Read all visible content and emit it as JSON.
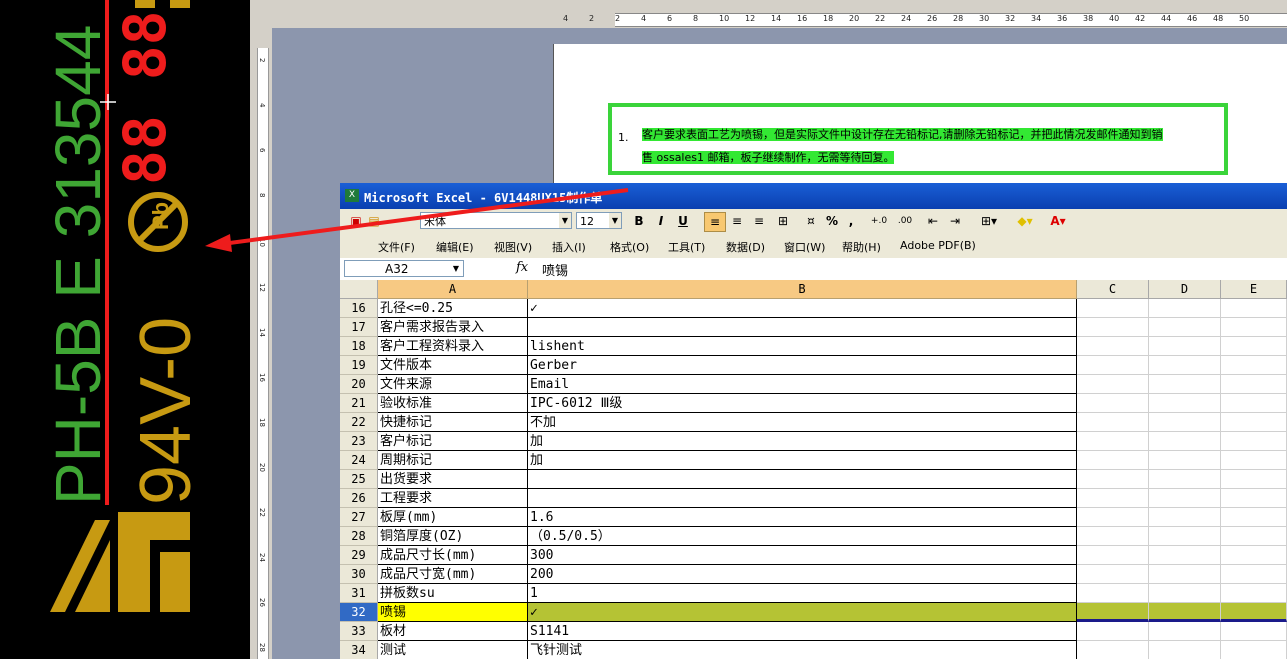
{
  "cad_panel": {
    "silkscreen_green": "PH-5B  E 313544",
    "silkscreen_yellow": "94V-0",
    "pb_free_symbol": "Pb",
    "seven_segment_digits": "88 88",
    "colors": {
      "green": "#3fa634",
      "yellow": "#c79a12",
      "red": "#ee1c1c"
    }
  },
  "word": {
    "ruler_ticks": [
      "4",
      "2",
      "2",
      "4",
      "6",
      "8",
      "10",
      "12",
      "14",
      "16",
      "18",
      "20",
      "22",
      "24",
      "26",
      "28",
      "30",
      "32",
      "34",
      "36",
      "38",
      "40",
      "42",
      "44",
      "46",
      "48",
      "50"
    ],
    "vruler_ticks": [
      "2",
      "4",
      "6",
      "8",
      "10",
      "12",
      "14",
      "16",
      "18",
      "20",
      "22",
      "24",
      "26",
      "28"
    ],
    "list_number": "1.",
    "note_line1": "客户要求表面工艺为喷锡，但是实际文件中设计存在无铅标记,请删除无铅标记，并把此情况发邮件通知到销",
    "note_line2": "售 ossales1 邮箱，板子继续制作，无需等待回复。",
    "highlight_color": "#33e833"
  },
  "excel": {
    "title": "Microsoft Excel - 6V1448UX15制作单",
    "font_name": "宋体",
    "font_size": "12",
    "toolbar": {
      "bold": "B",
      "italic": "I",
      "underline": "U",
      "percent": "%",
      "comma": ",",
      "font_color_label": "A"
    },
    "menu": [
      "文件(F)",
      "编辑(E)",
      "视图(V)",
      "插入(I)",
      "格式(O)",
      "工具(T)",
      "数据(D)",
      "窗口(W)",
      "帮助(H)",
      "Adobe PDF(B)"
    ],
    "name_box": "A32",
    "fx_label": "fx",
    "formula_content": "喷锡",
    "columns": [
      "A",
      "B",
      "C",
      "D",
      "E"
    ],
    "rows": [
      {
        "num": "16",
        "a": "孔径<=0.25",
        "b": "✓"
      },
      {
        "num": "17",
        "a": "客户需求报告录入",
        "b": ""
      },
      {
        "num": "18",
        "a": "客户工程资料录入",
        "b": "lishent"
      },
      {
        "num": "19",
        "a": "文件版本",
        "b": "Gerber"
      },
      {
        "num": "20",
        "a": "文件来源",
        "b": "Email"
      },
      {
        "num": "21",
        "a": "验收标准",
        "b": "IPC-6012 Ⅲ级"
      },
      {
        "num": "22",
        "a": "快捷标记",
        "b": "不加"
      },
      {
        "num": "23",
        "a": "客户标记",
        "b": "加"
      },
      {
        "num": "24",
        "a": "周期标记",
        "b": "加"
      },
      {
        "num": "25",
        "a": "出货要求",
        "b": ""
      },
      {
        "num": "26",
        "a": "工程要求",
        "b": ""
      },
      {
        "num": "27",
        "a": "板厚(mm)",
        "b": "1.6"
      },
      {
        "num": "28",
        "a": "铜箔厚度(OZ)",
        "b": "（0.5/0.5）"
      },
      {
        "num": "29",
        "a": "成品尺寸长(mm)",
        "b": "300"
      },
      {
        "num": "30",
        "a": "成品尺寸宽(mm)",
        "b": "200"
      },
      {
        "num": "31",
        "a": "拼板数su",
        "b": "1"
      },
      {
        "num": "32",
        "a": "喷锡",
        "b": "✓",
        "active": true
      },
      {
        "num": "33",
        "a": "板材",
        "b": "S1141"
      },
      {
        "num": "34",
        "a": "测试",
        "b": "飞针测试"
      }
    ],
    "active_row_color": "#b5c334",
    "active_cell_color": "#ffff00"
  }
}
